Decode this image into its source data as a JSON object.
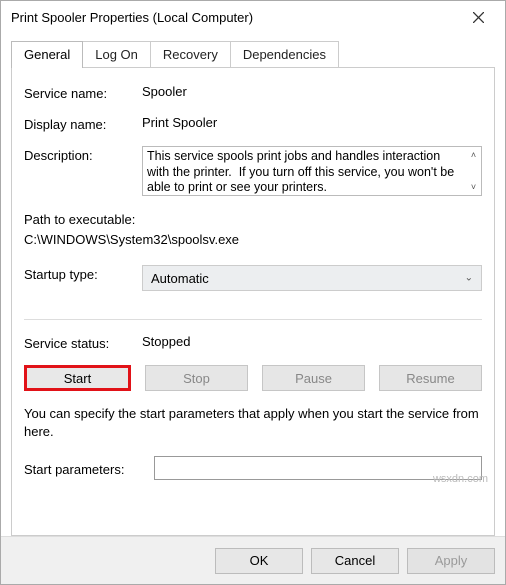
{
  "window": {
    "title": "Print Spooler Properties (Local Computer)"
  },
  "tabs": {
    "items": [
      {
        "label": "General"
      },
      {
        "label": "Log On"
      },
      {
        "label": "Recovery"
      },
      {
        "label": "Dependencies"
      }
    ],
    "activeIndex": 0
  },
  "general": {
    "serviceNameLabel": "Service name:",
    "serviceName": "Spooler",
    "displayNameLabel": "Display name:",
    "displayName": "Print Spooler",
    "descriptionLabel": "Description:",
    "description": "This service spools print jobs and handles interaction with the printer.  If you turn off this service, you won't be able to print or see your printers.",
    "pathLabel": "Path to executable:",
    "path": "C:\\WINDOWS\\System32\\spoolsv.exe",
    "startupTypeLabel": "Startup type:",
    "startupType": "Automatic",
    "serviceStatusLabel": "Service status:",
    "serviceStatus": "Stopped",
    "buttons": {
      "start": "Start",
      "stop": "Stop",
      "pause": "Pause",
      "resume": "Resume"
    },
    "note": "You can specify the start parameters that apply when you start the service from here.",
    "startParamsLabel": "Start parameters:",
    "startParamsValue": ""
  },
  "footer": {
    "ok": "OK",
    "cancel": "Cancel",
    "apply": "Apply"
  },
  "watermark": "wsxdn.com"
}
